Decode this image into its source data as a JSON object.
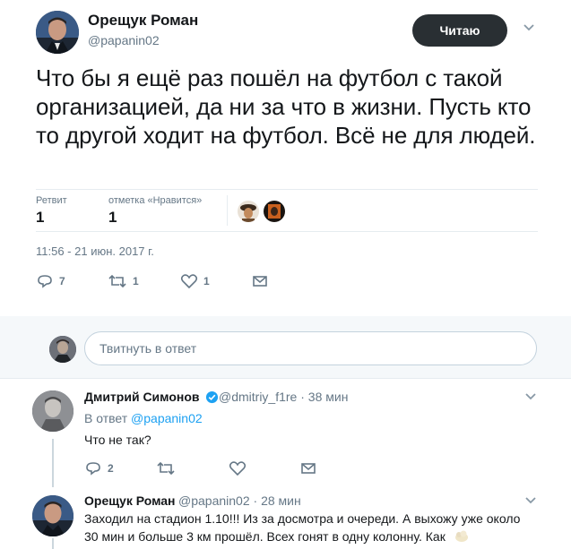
{
  "tweet": {
    "author_name": "Орещук Роман",
    "author_handle": "@papanin02",
    "follow_label": "Читаю",
    "text": "Что бы я ещё раз пошёл на футбол с такой организацией, да ни за что в жизни. Пусть кто то другой ходит на футбол. Всё не для людей.",
    "retweets_label": "Ретвит",
    "retweets_count": "1",
    "likes_label": "отметка «Нравится»",
    "likes_count": "1",
    "timestamp": "11:56 - 21 июн. 2017 г.",
    "actions": {
      "replies": "7",
      "retweets": "1",
      "likes": "1"
    }
  },
  "reply_box": {
    "placeholder": "Твитнуть в ответ"
  },
  "replies": [
    {
      "author_name": "Дмитрий Симонов",
      "verified": true,
      "author_handle": "@dmitriy_f1re",
      "time": "38 мин",
      "in_reply_prefix": "В ответ",
      "in_reply_handle": "@papanin02",
      "text": "Что не так?",
      "actions": {
        "replies": "2"
      }
    },
    {
      "author_name": "Орещук Роман",
      "author_handle": "@papanin02",
      "time": "28 мин",
      "text_line1": "Заходил на стадион 1.10!!! Из за досмотра и очереди. А выхожу уже около",
      "text_line2": "30 мин и больше 3 км прошёл. Всех гонят в одну колонну. Как"
    }
  ],
  "icons": {
    "reply": "reply-icon",
    "retweet": "retweet-icon",
    "like": "heart-icon",
    "dm": "envelope-icon",
    "more": "chevron-down-icon",
    "verified": "verified-badge-icon"
  },
  "colors": {
    "text": "#14171a",
    "secondary": "#657786",
    "link": "#1da1f2",
    "follow_bg": "#292f33",
    "border": "#e6ecf0",
    "band_bg": "#f5f8fa"
  }
}
